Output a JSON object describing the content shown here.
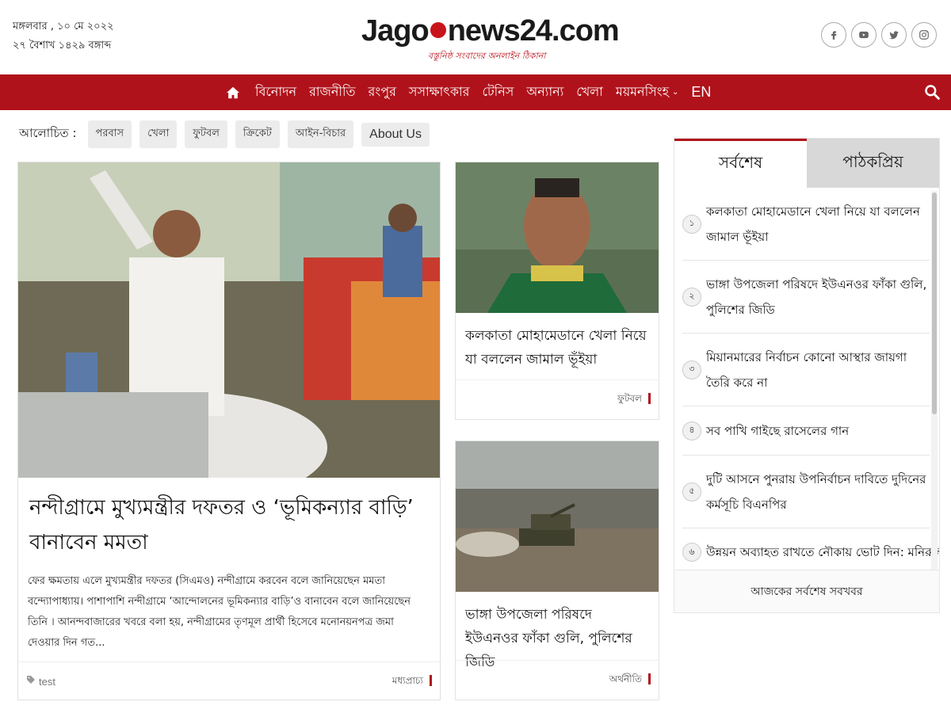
{
  "header": {
    "date_line_1": "মঙ্গলবার , ১০ মে ২০২২",
    "date_line_2": "২৭ বৈশাখ ১৪২৯ বঙ্গাব্দ",
    "logo_part_1": "Jago",
    "logo_part_2": "news24.com",
    "logo_tagline": "বস্তুনিষ্ঠ সংবাদের অনলাইন ঠিকানা",
    "socials": [
      "facebook-icon",
      "youtube-icon",
      "twitter-icon",
      "instagram-icon"
    ]
  },
  "nav": {
    "items": [
      "বিনোদন",
      "রাজনীতি",
      "রংপুর",
      "সসাক্ষাৎকার",
      "টেনিস",
      "অন্যান্য",
      "খেলা",
      "ময়মনসিংহ",
      "EN"
    ],
    "home_icon": "home-icon",
    "search_icon": "search-icon",
    "accent_color": "#b0121b"
  },
  "topics": {
    "label": "আলোচিত :",
    "items": [
      "পরবাস",
      "খেলা",
      "ফুটবল",
      "ক্রিকেট",
      "আইন-বিচার",
      "About Us"
    ]
  },
  "lead": {
    "title": "নন্দীগ্রামে মুখ্যমন্ত্রীর দফতর ও ‘ভূমিকন্যার বাড়ি’ বানাবেন মমতা",
    "summary": "ফের ক্ষমতায় এলে মুখ্যমন্ত্রীর দফতর (সিএমও) নন্দীগ্রামে করবেন বলে জানিয়েছেন মমতা বন্দ্যোপাধ্যায়। পাশাপাশি নন্দীগ্রামে ‘আন্দোলনের ভূমিকন্যার বাড়ি’ও বানাবেন বলে জানিয়েছেন তিনি ।  আনন্দবাজারের খবরে বলা হয়, নন্দীগ্রামের তৃণমূল প্রার্থী হিসেবে মনোনয়নপত্র জমা দেওয়ার দিন গত...",
    "tag": "test",
    "category": "মধ্যপ্রাচ্য"
  },
  "stories": [
    {
      "title": "কলকাতা মোহামেডানে খেলা নিয়ে যা বললেন জামাল ভূঁইয়া",
      "category": "ফুটবল"
    },
    {
      "title": "ভাঙ্গা উপজেলা পরিষদে ইউএনওর ফাঁকা গুলি, পুলিশের জিডি",
      "category": "অর্থনীতি"
    }
  ],
  "sidebar": {
    "tab_latest": "সর্বশেষ",
    "tab_popular": "পাঠকপ্রিয়",
    "items": [
      {
        "num": "১",
        "text": "কলকাতা মোহামেডানে খেলা নিয়ে যা বললেন জামাল ভূঁইয়া"
      },
      {
        "num": "২",
        "text": "ভাঙ্গা উপজেলা পরিষদে ইউএনওর ফাঁকা গুলি, পুলিশের জিডি"
      },
      {
        "num": "৩",
        "text": "মিয়ানমারের নির্বাচন কোনো আস্থার জায়গা তৈরি করে না"
      },
      {
        "num": "৪",
        "text": "সব পাখি গাইছে রাসেলের গান"
      },
      {
        "num": "৫",
        "text": "দুটি আসনে পুনরায় উপনির্বাচন দাবিতে দুদিনের কর্মসূচি বিএনপির"
      },
      {
        "num": "৬",
        "text": "উন্নয়ন অব্যাহত রাখতে নৌকায় ভোট দিন: মনিরুল"
      }
    ],
    "footer_link": "আজকের সর্বশেষ সবখবর"
  }
}
